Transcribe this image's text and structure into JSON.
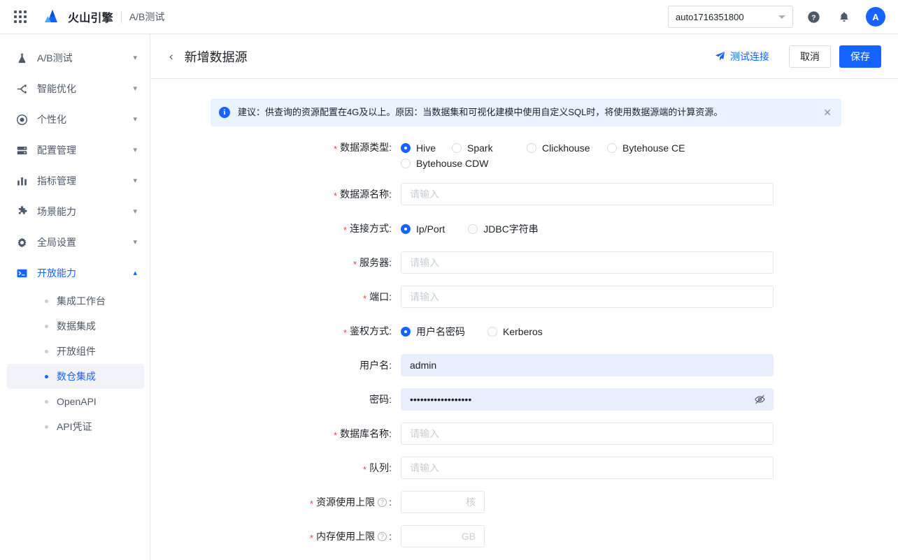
{
  "topbar": {
    "apps_icon": "apps-grid-icon",
    "brand_name": "火山引擎",
    "app_name": "A/B测试",
    "project": "auto1716351800",
    "help_icon": "help-icon",
    "bell_icon": "bell-icon",
    "avatar_initial": "A"
  },
  "sidebar": {
    "items": [
      {
        "label": "A/B测试",
        "icon": "flask-icon",
        "chevron": "chevron-down"
      },
      {
        "label": "智能优化",
        "icon": "optimize-icon",
        "chevron": "chevron-down"
      },
      {
        "label": "个性化",
        "icon": "target-icon",
        "chevron": "chevron-down"
      },
      {
        "label": "配置管理",
        "icon": "server-icon",
        "chevron": "chevron-down"
      },
      {
        "label": "指标管理",
        "icon": "bar-chart-icon",
        "chevron": "chevron-down"
      },
      {
        "label": "场景能力",
        "icon": "puzzle-icon",
        "chevron": "chevron-down"
      },
      {
        "label": "全局设置",
        "icon": "gear-icon",
        "chevron": "chevron-down"
      },
      {
        "label": "开放能力",
        "icon": "terminal-icon",
        "chevron": "chevron-up"
      }
    ],
    "sub_items": [
      {
        "label": "集成工作台"
      },
      {
        "label": "数据集成"
      },
      {
        "label": "开放组件"
      },
      {
        "label": "数仓集成"
      },
      {
        "label": "OpenAPI"
      },
      {
        "label": "API凭证"
      }
    ],
    "active_sub_index": 3
  },
  "page_header": {
    "back_icon": "chevron-left-icon",
    "title": "新增数据源",
    "test_connection": "测试连接",
    "cancel": "取消",
    "save": "保存"
  },
  "alert": {
    "text": "建议：供查询的资源配置在4G及以上。原因：当数据集和可视化建模中使用自定义SQL时，将使用数据源端的计算资源。",
    "icon": "info-circle-icon",
    "close_icon": "close-icon"
  },
  "form": {
    "source_type": {
      "label": "数据源类型:",
      "required": true,
      "options": [
        "Hive",
        "Spark",
        "Clickhouse",
        "Bytehouse CE",
        "Bytehouse CDW"
      ],
      "selected": "Hive"
    },
    "source_name": {
      "label": "数据源名称:",
      "required": true,
      "value": "",
      "placeholder": "请输入"
    },
    "connection_mode": {
      "label": "连接方式:",
      "required": true,
      "options": [
        "Ip/Port",
        "JDBC字符串"
      ],
      "selected": "Ip/Port"
    },
    "server": {
      "label": "服务器:",
      "required": true,
      "value": "",
      "placeholder": "请输入"
    },
    "port": {
      "label": "端口:",
      "required": true,
      "value": "",
      "placeholder": "请输入"
    },
    "auth_mode": {
      "label": "鉴权方式:",
      "required": true,
      "options": [
        "用户名密码",
        "Kerberos"
      ],
      "selected": "用户名密码"
    },
    "username": {
      "label": "用户名:",
      "required": false,
      "value": "admin",
      "placeholder": ""
    },
    "password": {
      "label": "密码:",
      "required": false,
      "value": "••••••••••••••••••",
      "toggle_icon": "eye-off-icon"
    },
    "database_name": {
      "label": "数据库名称:",
      "required": true,
      "value": "",
      "placeholder": "请输入"
    },
    "queue": {
      "label": "队列:",
      "required": true,
      "value": "",
      "placeholder": "请输入"
    },
    "cpu_limit": {
      "label": "资源使用上限",
      "label_suffix": ":",
      "required": true,
      "value": "",
      "unit": "核",
      "help_icon": "question-circle-icon"
    },
    "memory_limit": {
      "label": "内存使用上限",
      "label_suffix": ":",
      "required": true,
      "value": "",
      "unit": "GB",
      "help_icon": "question-circle-icon"
    }
  },
  "colors": {
    "brand_blue": "#1664ff",
    "alert_bg": "#e8f3ff",
    "required_red": "#f53f3f",
    "autofill_bg": "#e8eefc"
  }
}
